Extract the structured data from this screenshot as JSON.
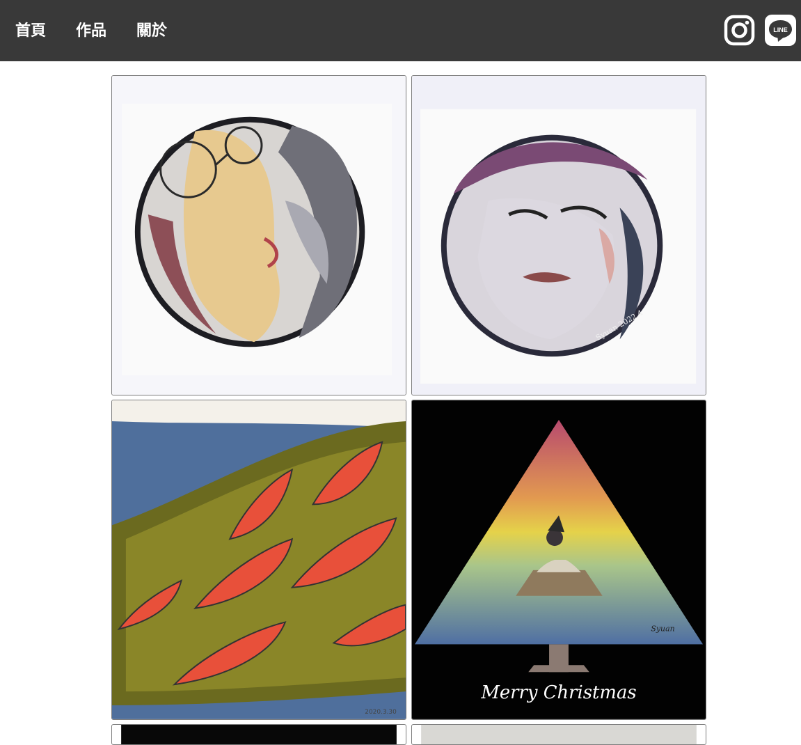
{
  "navbar": {
    "links": [
      {
        "label": "首頁"
      },
      {
        "label": "作品"
      },
      {
        "label": "關於"
      }
    ],
    "social": [
      {
        "icon": "instagram-icon"
      },
      {
        "icon": "line-icon",
        "text": "LINE"
      }
    ]
  },
  "gallery": {
    "items": [
      {
        "artwork": "watercolor-portrait-glasses",
        "signature": ""
      },
      {
        "artwork": "watercolor-portrait-eyes-closed",
        "signature": "Syuan 2022.4"
      },
      {
        "artwork": "fish-on-leaf-hillside",
        "signature": "2020.3.30"
      },
      {
        "artwork": "christmas-tree-dog",
        "caption": "Merry Christmas",
        "signature": "Syuan"
      }
    ]
  },
  "colors": {
    "navbar_bg": "#393939",
    "nav_text": "#ffffff",
    "page_bg": "#ffffff"
  }
}
